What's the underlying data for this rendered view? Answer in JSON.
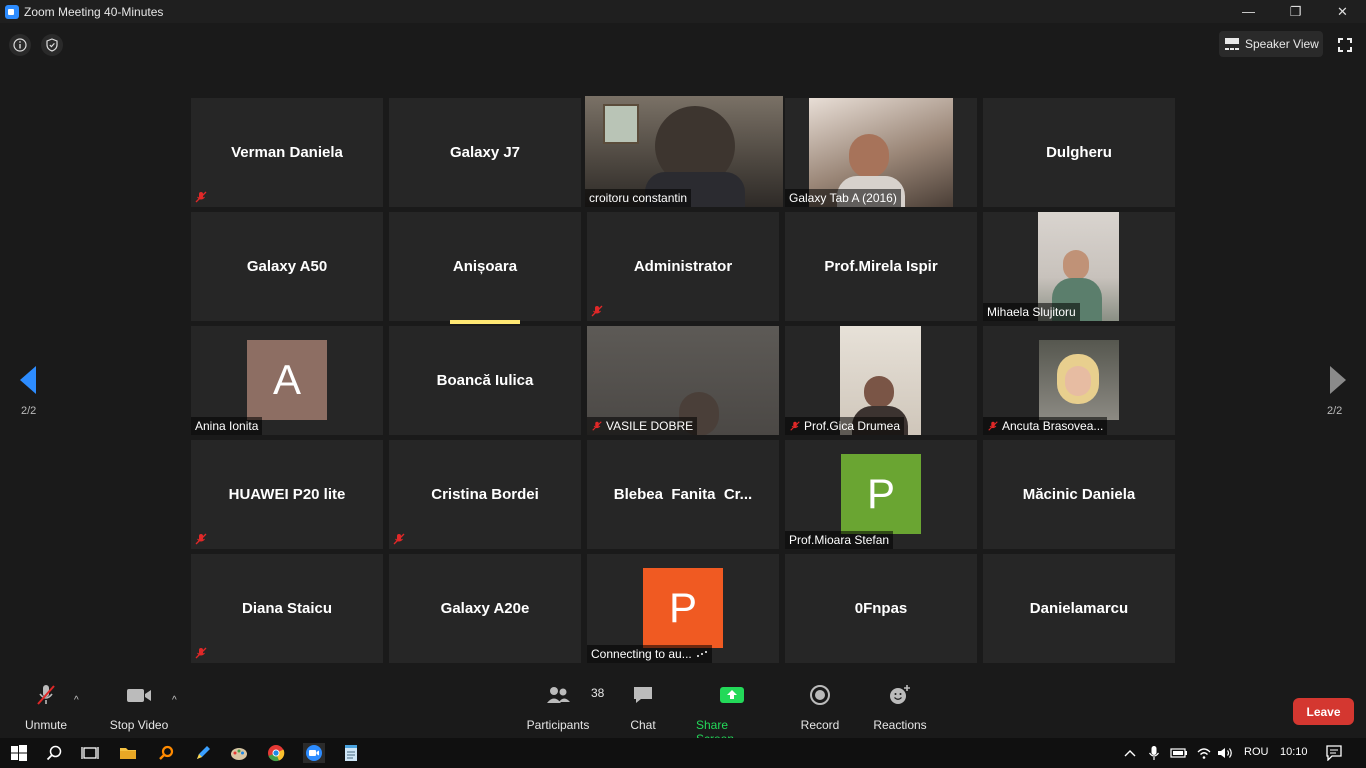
{
  "window": {
    "title": "Zoom Meeting 40-Minutes",
    "minimize": "—",
    "maximize": "❐",
    "close": "✕"
  },
  "topbar": {
    "speaker_view_label": "Speaker View"
  },
  "pager": {
    "left_label": "2/2",
    "right_label": "2/2"
  },
  "tiles": [
    {
      "id": "verman",
      "name": "Verman Daniela",
      "display": "center",
      "muted": true
    },
    {
      "id": "galaxy-j7",
      "name": "Galaxy J7",
      "display": "center",
      "muted": false
    },
    {
      "id": "croitoru",
      "name": "croitoru constantin",
      "display": "video",
      "muted": false,
      "active": true
    },
    {
      "id": "galaxy-tab",
      "name": "Galaxy Tab A (2016)",
      "display": "video",
      "muted": false
    },
    {
      "id": "dulgheru",
      "name": "Dulgheru",
      "display": "center",
      "muted": false
    },
    {
      "id": "galaxy-a50",
      "name": "Galaxy A50",
      "display": "center",
      "muted": false
    },
    {
      "id": "anisoara",
      "name": "Anișoara",
      "display": "center",
      "muted": false,
      "speaking": true
    },
    {
      "id": "administrator",
      "name": "Administrator",
      "display": "center",
      "muted": true
    },
    {
      "id": "mirela",
      "name": "Prof.Mirela Ispir",
      "display": "center",
      "muted": false
    },
    {
      "id": "mihaela",
      "name": "Mihaela Slujitoru",
      "display": "video",
      "muted": false
    },
    {
      "id": "anina",
      "name": "Anina Ionita",
      "display": "avatar",
      "avatar_letter": "A",
      "avatar_color": "#8d6e63",
      "muted": false
    },
    {
      "id": "boanca",
      "name": "Boancă Iulica",
      "display": "center",
      "muted": false
    },
    {
      "id": "vasile",
      "name": "VASILE DOBRE",
      "display": "video",
      "muted": true
    },
    {
      "id": "gica",
      "name": "Prof.Gica Drumea",
      "display": "video",
      "muted": true
    },
    {
      "id": "ancuta",
      "name": "Ancuta Brasovea...",
      "display": "video",
      "muted": true
    },
    {
      "id": "huawei",
      "name": "HUAWEI P20 lite",
      "display": "center",
      "muted": true
    },
    {
      "id": "cristina",
      "name": "Cristina Bordei",
      "display": "center",
      "muted": true
    },
    {
      "id": "blebea",
      "name": "Blebea  Fanita  Cr...",
      "display": "center",
      "muted": false
    },
    {
      "id": "mioara",
      "name": "Prof.Mioara Stefan",
      "display": "avatar",
      "avatar_letter": "P",
      "avatar_color": "#6aa532",
      "muted": false
    },
    {
      "id": "macinic",
      "name": "Măcinic Daniela",
      "display": "center",
      "muted": false
    },
    {
      "id": "diana",
      "name": "Diana Staicu",
      "display": "center",
      "muted": true
    },
    {
      "id": "galaxy-a20e",
      "name": "Galaxy A20e",
      "display": "center",
      "muted": false
    },
    {
      "id": "connecting",
      "name": "Connecting to au...",
      "display": "avatar",
      "avatar_letter": "P",
      "avatar_color": "#f05a22",
      "muted": false,
      "connecting": true
    },
    {
      "id": "0fnpas",
      "name": "0Fnpas",
      "display": "center",
      "muted": false
    },
    {
      "id": "danielamarcu",
      "name": "Danielamarcu",
      "display": "center",
      "muted": false
    }
  ],
  "toolbar": {
    "unmute_label": "Unmute",
    "stop_video_label": "Stop Video",
    "participants_label": "Participants",
    "participants_count": "38",
    "chat_label": "Chat",
    "share_screen_label": "Share Screen",
    "record_label": "Record",
    "reactions_label": "Reactions",
    "leave_label": "Leave"
  },
  "colors": {
    "share_green": "#23d959",
    "leave_red": "#d43730",
    "active_outline": "#b5e83a",
    "speaking_bar": "#ffe873",
    "muted_red": "#e02828",
    "pager_blue": "#2d8cff"
  },
  "taskbar": {
    "language": "ROU",
    "time": "10:10"
  }
}
